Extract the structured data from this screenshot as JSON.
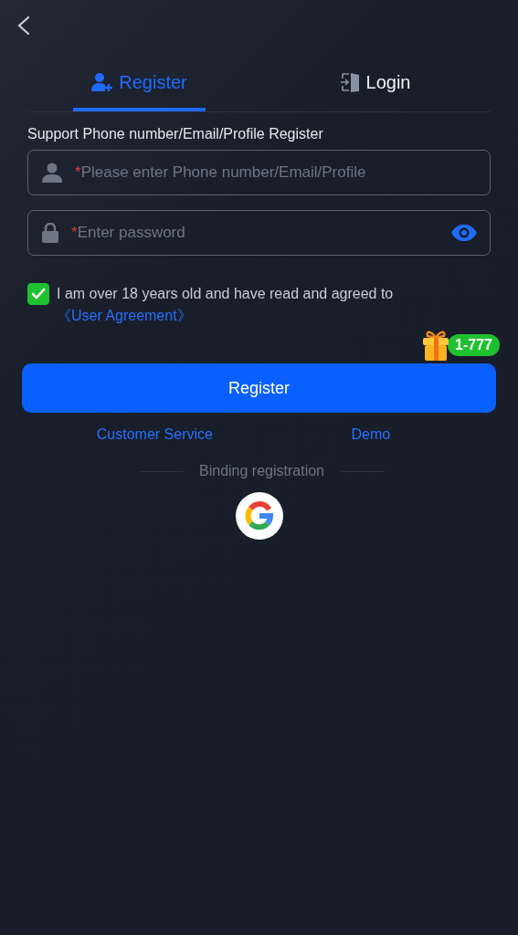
{
  "tabs": [
    {
      "label": "Register",
      "selected": true,
      "kind": "register"
    },
    {
      "label": "Login",
      "selected": false,
      "kind": "login"
    }
  ],
  "hint": "Support Phone number/Email/Profile Register",
  "fields": [
    {
      "kind": "account",
      "required_mark": "*",
      "placeholder": "Please enter Phone number/Email/Profile"
    },
    {
      "kind": "password",
      "required_mark": "*",
      "placeholder": "Enter password"
    }
  ],
  "agreement": {
    "checked": true,
    "text": "I am over 18 years old and have read and agreed to",
    "link": "《User Agreement》"
  },
  "bonus_badge": "1-777",
  "register_button": "Register",
  "links": [
    "Customer Service",
    "Demo"
  ],
  "divider_label": "Binding registration"
}
